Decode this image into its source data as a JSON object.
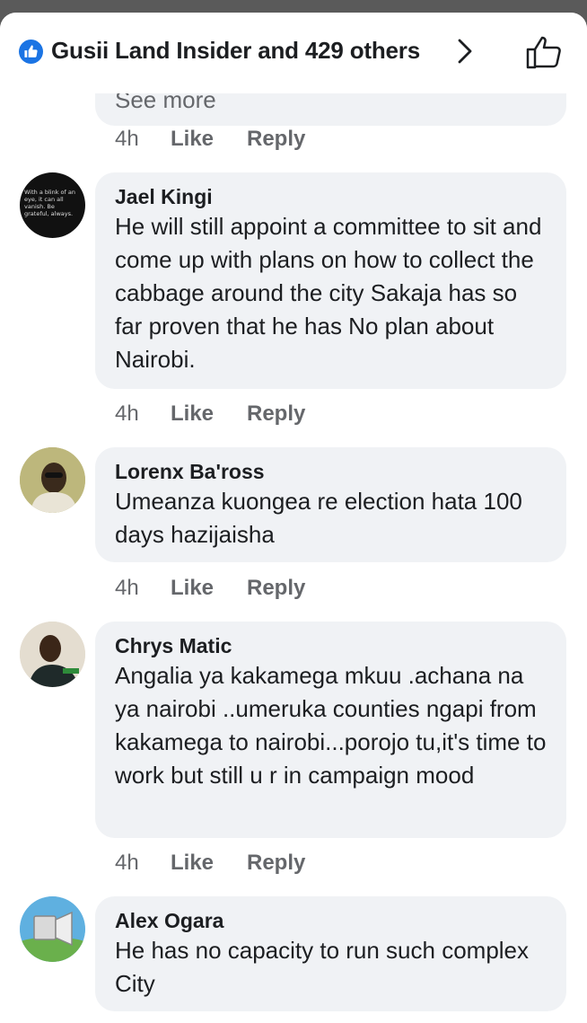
{
  "header": {
    "reactors": "Gusii Land Insider and 429 others"
  },
  "previous": {
    "see_more": "See more",
    "time": "4h",
    "like": "Like",
    "reply": "Reply"
  },
  "comments": [
    {
      "author": "Jael Kingi",
      "avatar_text": "With a blink of an eye, it can all vanish. Be grateful, always.",
      "text": "He will still appoint a committee to sit and come up with plans on how to collect the cabbage around the city Sakaja has so far proven that he has No plan about Nairobi.",
      "time": "4h",
      "like": "Like",
      "reply": "Reply"
    },
    {
      "author": "Lorenx Ba'ross",
      "text": "Umeanza kuongea re election hata 100 days hazijaisha",
      "time": "4h",
      "like": "Like",
      "reply": "Reply"
    },
    {
      "author": "Chrys Matic",
      "text": "Angalia ya kakamega mkuu .achana na ya nairobi ..umeruka counties ngapi from kakamega to nairobi...porojo tu,it's time to work but still u r in campaign mood",
      "time": "4h",
      "like": "Like",
      "reply": "Reply"
    },
    {
      "author": "Alex Ogara",
      "text": "He has no capacity to run such complex City"
    }
  ],
  "colors": {
    "accent": "#1b74e4",
    "bubble": "#f0f2f5",
    "meta": "#65676b"
  }
}
